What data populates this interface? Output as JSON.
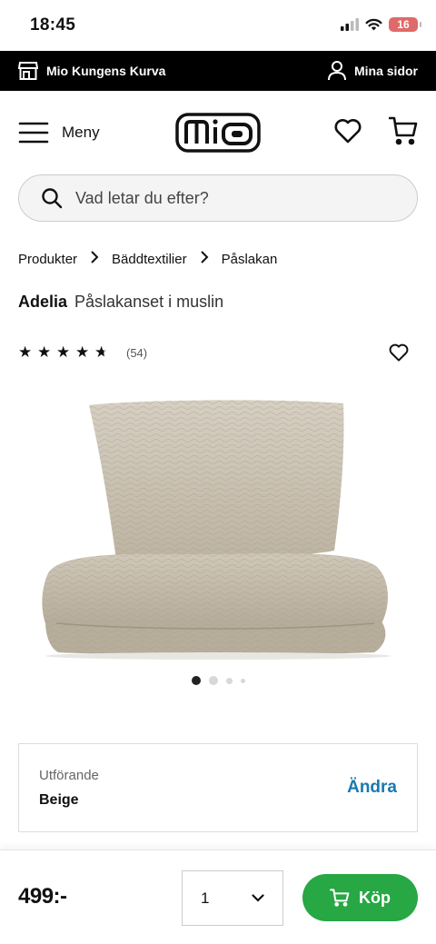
{
  "status_bar": {
    "time": "18:45",
    "battery": "16"
  },
  "store_bar": {
    "store_name": "Mio Kungens Kurva",
    "account_label": "Mina sidor"
  },
  "header": {
    "menu_label": "Meny",
    "logo_text": "mio"
  },
  "search": {
    "placeholder": "Vad letar du efter?"
  },
  "breadcrumb": [
    "Produkter",
    "Bäddtextilier",
    "Påslakan"
  ],
  "product": {
    "brand": "Adelia",
    "subtitle": "Påslakanset i muslin",
    "rating": 4.5,
    "review_count": "(54)",
    "image_count": 4,
    "active_image": 1
  },
  "variant": {
    "label": "Utförande",
    "value": "Beige",
    "change_label": "Ändra"
  },
  "purchase": {
    "price": "499:-",
    "quantity": "1",
    "buy_label": "Köp"
  },
  "colors": {
    "accent_green": "#28a745",
    "link_blue": "#1a78b0",
    "fabric": "#c9c0b0"
  }
}
